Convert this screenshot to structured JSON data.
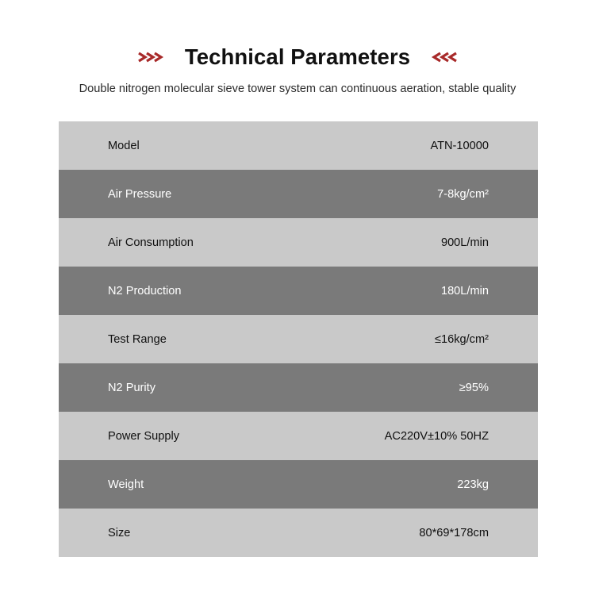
{
  "header": {
    "title": "Technical Parameters",
    "left_chevron_icon": "chevrons-right-icon",
    "right_chevron_icon": "chevrons-left-icon",
    "accent_color": "#a82a2a",
    "subtitle": "Double nitrogen molecular sieve tower system can continuous aeration, stable quality"
  },
  "spec_table": {
    "row_light_color": "#c9c9c9",
    "row_dark_color": "#7a7a7a",
    "rows": [
      {
        "label": "Model",
        "value": "ATN-10000"
      },
      {
        "label": "Air Pressure",
        "value": "7-8kg/cm²"
      },
      {
        "label": "Air Consumption",
        "value": "900L/min"
      },
      {
        "label": "N2 Production",
        "value": "180L/min"
      },
      {
        "label": "Test Range",
        "value": "≤16kg/cm²"
      },
      {
        "label": "N2 Purity",
        "value": "≥95%"
      },
      {
        "label": "Power Supply",
        "value": "AC220V±10% 50HZ"
      },
      {
        "label": "Weight",
        "value": "223kg"
      },
      {
        "label": "Size",
        "value": "80*69*178cm"
      }
    ]
  }
}
